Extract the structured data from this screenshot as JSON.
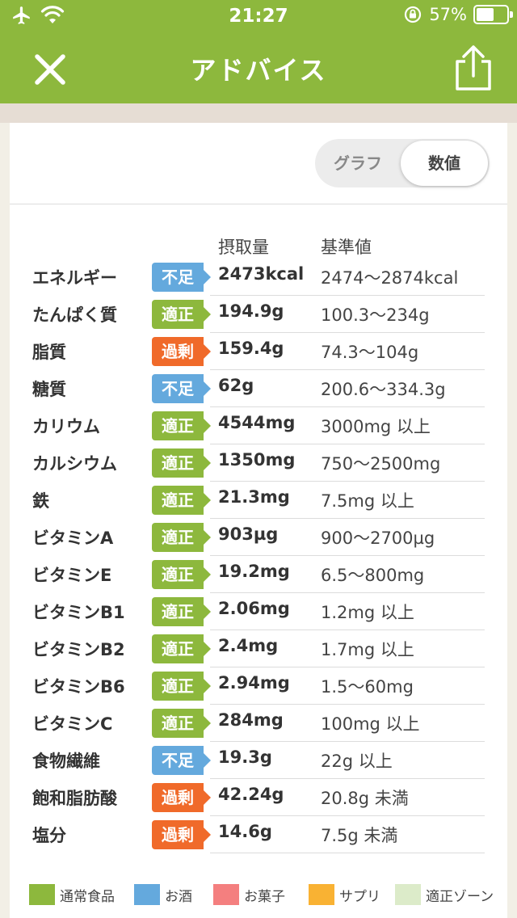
{
  "status_bar": {
    "time": "21:27",
    "battery_percent": "57%",
    "battery_level": 0.57
  },
  "nav": {
    "title": "アドバイス",
    "close_icon": "close-icon",
    "share_icon": "share-icon"
  },
  "toggle": {
    "graph_label": "グラフ",
    "numbers_label": "数値",
    "selected": "数値"
  },
  "table": {
    "col_intake": "摂取量",
    "col_standard": "基準値",
    "rows": [
      {
        "name": "エネルギー",
        "status": "不足",
        "kind": "low",
        "intake": "2473kcal",
        "standard": "2474～2874kcal"
      },
      {
        "name": "たんぱく質",
        "status": "適正",
        "kind": "ok",
        "intake": "194.9g",
        "standard": "100.3～234g"
      },
      {
        "name": "脂質",
        "status": "過剰",
        "kind": "over",
        "intake": "159.4g",
        "standard": "74.3～104g"
      },
      {
        "name": "糖質",
        "status": "不足",
        "kind": "low",
        "intake": "62g",
        "standard": "200.6～334.3g"
      },
      {
        "name": "カリウム",
        "status": "適正",
        "kind": "ok",
        "intake": "4544mg",
        "standard": "3000mg 以上"
      },
      {
        "name": "カルシウム",
        "status": "適正",
        "kind": "ok",
        "intake": "1350mg",
        "standard": "750～2500mg"
      },
      {
        "name": "鉄",
        "status": "適正",
        "kind": "ok",
        "intake": "21.3mg",
        "standard": "7.5mg 以上"
      },
      {
        "name": "ビタミンA",
        "status": "適正",
        "kind": "ok",
        "intake": "903µg",
        "standard": "900～2700µg"
      },
      {
        "name": "ビタミンE",
        "status": "適正",
        "kind": "ok",
        "intake": "19.2mg",
        "standard": "6.5～800mg"
      },
      {
        "name": "ビタミンB1",
        "status": "適正",
        "kind": "ok",
        "intake": "2.06mg",
        "standard": "1.2mg 以上"
      },
      {
        "name": "ビタミンB2",
        "status": "適正",
        "kind": "ok",
        "intake": "2.4mg",
        "standard": "1.7mg 以上"
      },
      {
        "name": "ビタミンB6",
        "status": "適正",
        "kind": "ok",
        "intake": "2.94mg",
        "standard": "1.5～60mg"
      },
      {
        "name": "ビタミンC",
        "status": "適正",
        "kind": "ok",
        "intake": "284mg",
        "standard": "100mg 以上"
      },
      {
        "name": "食物繊維",
        "status": "不足",
        "kind": "low",
        "intake": "19.3g",
        "standard": "22g 以上"
      },
      {
        "name": "飽和脂肪酸",
        "status": "過剰",
        "kind": "over",
        "intake": "42.24g",
        "standard": "20.8g 未満"
      },
      {
        "name": "塩分",
        "status": "過剰",
        "kind": "over",
        "intake": "14.6g",
        "standard": "7.5g 未満"
      }
    ]
  },
  "legend": [
    {
      "label": "通常食品",
      "color": "#8db83d"
    },
    {
      "label": "お酒",
      "color": "#64a9dd"
    },
    {
      "label": "お菓子",
      "color": "#f47f7f"
    },
    {
      "label": "サプリ",
      "color": "#f9b233"
    },
    {
      "label": "適正ゾーン",
      "color": "#dcebc9"
    }
  ]
}
